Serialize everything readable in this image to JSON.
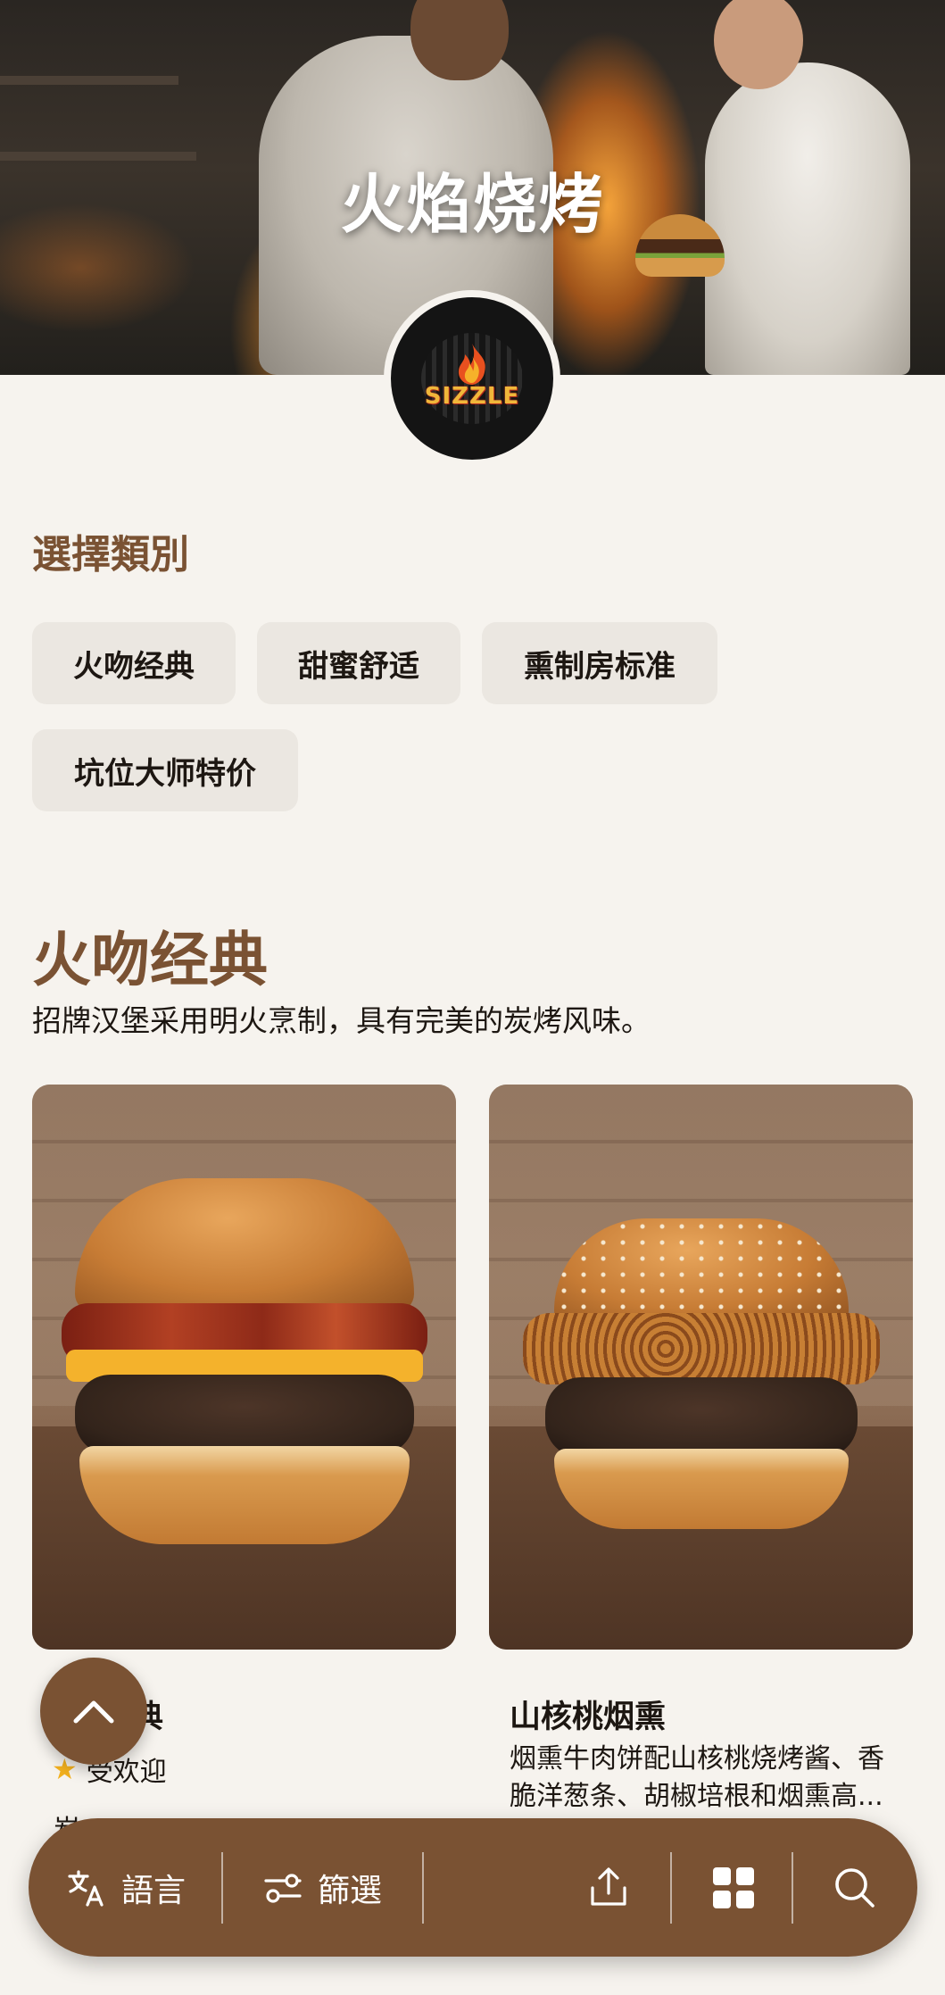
{
  "hero": {
    "title": "火焰烧烤",
    "logo_text": "SIZZLE"
  },
  "categories": {
    "heading": "選擇類別",
    "chips": [
      "火吻经典",
      "甜蜜舒适",
      "熏制房标准",
      "坑位大师特价"
    ]
  },
  "section": {
    "title": "火吻经典",
    "description": "招牌汉堡采用明火烹制，具有完美的炭烤风味。"
  },
  "cards": [
    {
      "name": "火吻经典",
      "visible_name_fragment": "典",
      "badge": "受欢迎",
      "description_fragment": "炭"
    },
    {
      "name": "山核桃烟熏",
      "description": "烟熏牛肉饼配山核桃烧烤酱、香脆洋葱条、胡椒培根和烟熏高..."
    }
  ],
  "bottom_bar": {
    "language_label": "語言",
    "filter_label": "篩選"
  },
  "colors": {
    "accent": "#7a5233",
    "background": "#f6f3ee",
    "chip": "#ebe7e1",
    "star": "#f2b01e"
  }
}
